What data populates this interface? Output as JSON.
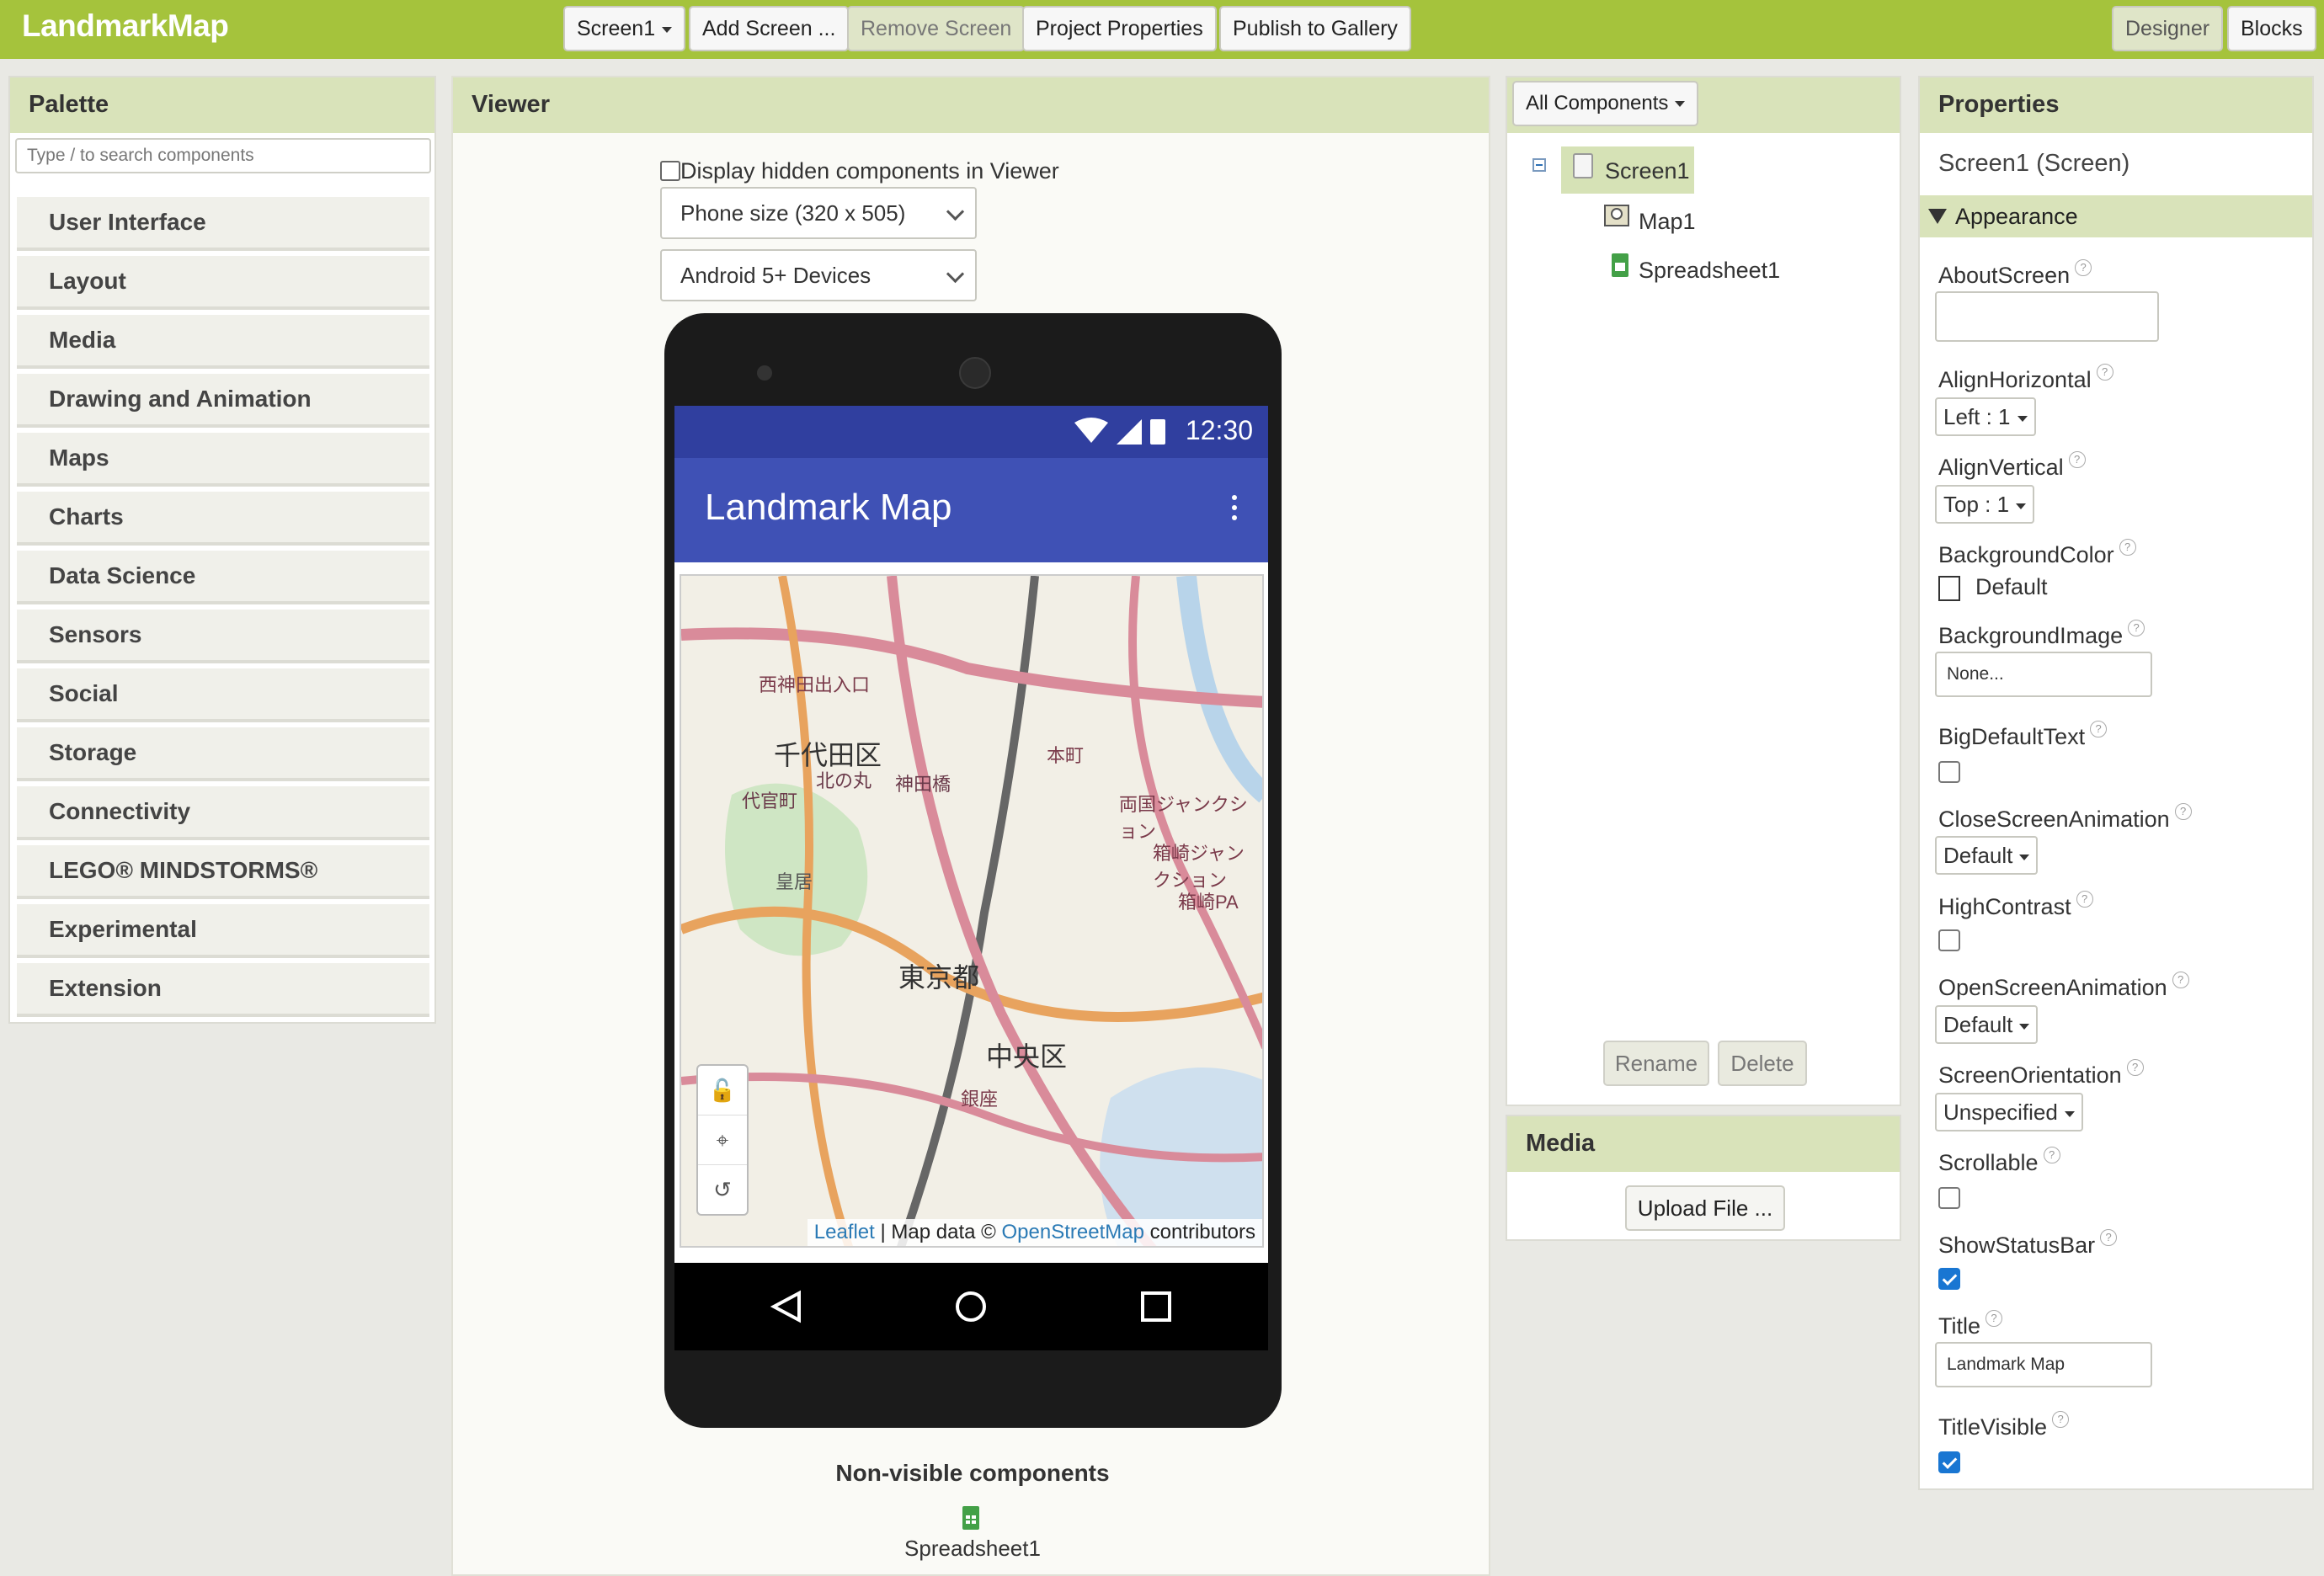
{
  "topbar": {
    "app_title": "LandmarkMap",
    "screen_dropdown": "Screen1",
    "add_screen": "Add Screen ...",
    "remove_screen": "Remove Screen",
    "project_properties": "Project Properties",
    "publish_gallery": "Publish to Gallery",
    "designer": "Designer",
    "blocks": "Blocks"
  },
  "palette": {
    "title": "Palette",
    "search_placeholder": "Type / to search components",
    "categories": [
      "User Interface",
      "Layout",
      "Media",
      "Drawing and Animation",
      "Maps",
      "Charts",
      "Data Science",
      "Sensors",
      "Social",
      "Storage",
      "Connectivity",
      "LEGO® MINDSTORMS®",
      "Experimental",
      "Extension"
    ]
  },
  "viewer": {
    "title": "Viewer",
    "hidden_checkbox_label": "Display hidden components in Viewer",
    "size_select": "Phone size (320 x 505)",
    "theme_select": "Android 5+ Devices",
    "phone": {
      "time": "12:30",
      "app_title": "Landmark Map",
      "map_labels": [
        "西神田出入口",
        "千代田区",
        "北の丸",
        "代官町",
        "神田橋",
        "皇居",
        "本町",
        "両国ジャンクション",
        "箱崎ジャンクション",
        "箱崎PA",
        "東京都",
        "中央区",
        "銀座"
      ],
      "attribution": {
        "leaflet": "Leaflet",
        "map_data": "| Map data ©",
        "osm": "OpenStreetMap",
        "contributors": "contributors"
      }
    },
    "nonvisible_title": "Non-visible components",
    "nonvisible_items": [
      "Spreadsheet1"
    ]
  },
  "components": {
    "dropdown": "All Components",
    "tree": [
      "Screen1",
      "Map1",
      "Spreadsheet1"
    ],
    "rename": "Rename",
    "delete": "Delete"
  },
  "media": {
    "title": "Media",
    "upload": "Upload File ..."
  },
  "properties": {
    "title": "Properties",
    "subtitle": "Screen1 (Screen)",
    "section": "Appearance",
    "about_screen": "AboutScreen",
    "align_horizontal": "AlignHorizontal",
    "align_horizontal_value": "Left : 1",
    "align_vertical": "AlignVertical",
    "align_vertical_value": "Top : 1",
    "background_color": "BackgroundColor",
    "background_color_value": "Default",
    "background_image": "BackgroundImage",
    "background_image_value": "None...",
    "big_default_text": "BigDefaultText",
    "close_screen_animation": "CloseScreenAnimation",
    "close_screen_animation_value": "Default",
    "high_contrast": "HighContrast",
    "open_screen_animation": "OpenScreenAnimation",
    "open_screen_animation_value": "Default",
    "screen_orientation": "ScreenOrientation",
    "screen_orientation_value": "Unspecified",
    "scrollable": "Scrollable",
    "show_status_bar": "ShowStatusBar",
    "title_prop": "Title",
    "title_value": "Landmark Map",
    "title_visible": "TitleVisible",
    "help_glyph": "?"
  },
  "colors": {
    "topbar": "#a5c33c",
    "panel_header": "#d9e3ba",
    "phone_status": "#303f9f",
    "phone_appbar": "#3f51b5",
    "checkbox_on": "#1976d2"
  }
}
